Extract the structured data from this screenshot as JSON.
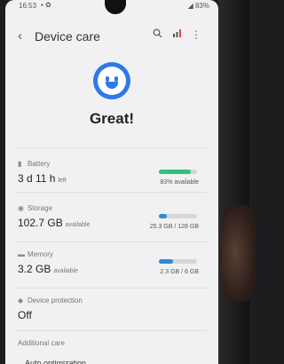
{
  "status_bar": {
    "time": "16:53",
    "battery": "83%"
  },
  "header": {
    "back_icon": "chevron-left-icon",
    "title": "Device care"
  },
  "summary": {
    "status_icon": "smiley-icon",
    "status_text": "Great!"
  },
  "battery": {
    "label": "Battery",
    "value": "3 d 11 h",
    "suffix": "left",
    "detail": "83% available",
    "level": 0.83,
    "color": "#2fc27c"
  },
  "storage": {
    "label": "Storage",
    "value": "102.7 GB",
    "suffix": "available",
    "detail": "25.3 GB / 128 GB",
    "level": 0.2,
    "color": "#2d8ad8"
  },
  "memory": {
    "label": "Memory",
    "value": "3.2 GB",
    "suffix": "available",
    "detail": "2.3 GB / 6 GB",
    "level": 0.38,
    "color": "#2d8ad8"
  },
  "device_protection": {
    "label": "Device protection",
    "value": "Off"
  },
  "additional": {
    "label": "Additional care"
  }
}
